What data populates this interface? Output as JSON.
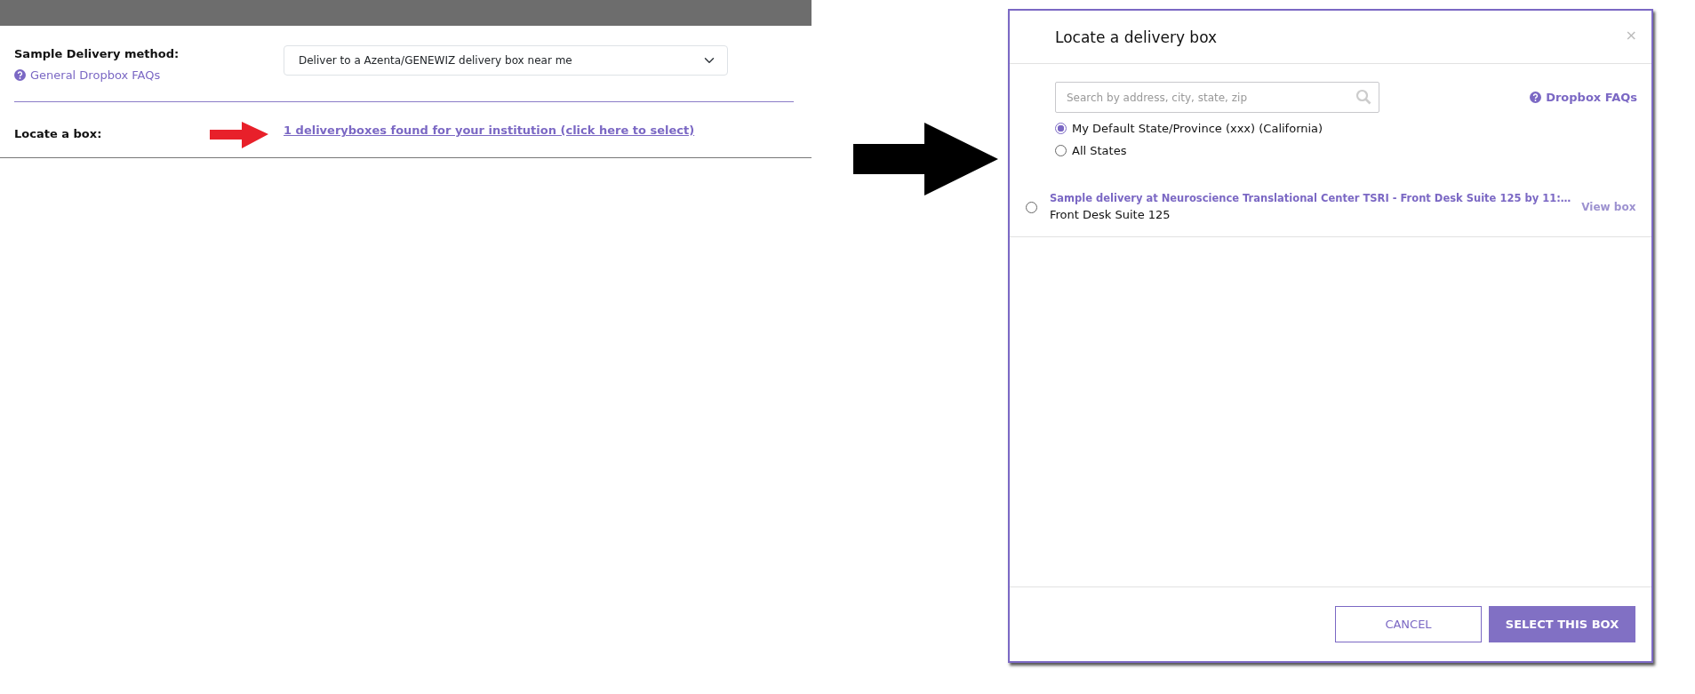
{
  "form": {
    "method_label": "Sample Delivery method:",
    "method_value": "Deliver to a Azenta/GENEWIZ delivery box near me",
    "faq_link": "General Dropbox FAQs",
    "locate_label": "Locate a box:",
    "locate_link": "1 deliveryboxes found for your institution (click here to select)"
  },
  "modal": {
    "title": "Locate a delivery box",
    "close": "×",
    "search": {
      "placeholder": "Search by address, city, state, zip"
    },
    "faq_link": "Dropbox FAQs",
    "scopes": [
      {
        "label": "My Default State/Province (xxx) (California)",
        "selected": true
      },
      {
        "label": "All States",
        "selected": false
      }
    ],
    "boxes": [
      {
        "title": "Sample delivery at Neuroscience Translational Center TSRI - Front Desk Suite 125 by 11:…",
        "location": "Front Desk Suite 125",
        "selected": false,
        "view": "View box",
        "view_disabled": true
      }
    ],
    "buttons": [
      {
        "label": "CANCEL",
        "kind": "outline"
      },
      {
        "label": "SELECT THIS BOX",
        "kind": "primary"
      }
    ]
  }
}
